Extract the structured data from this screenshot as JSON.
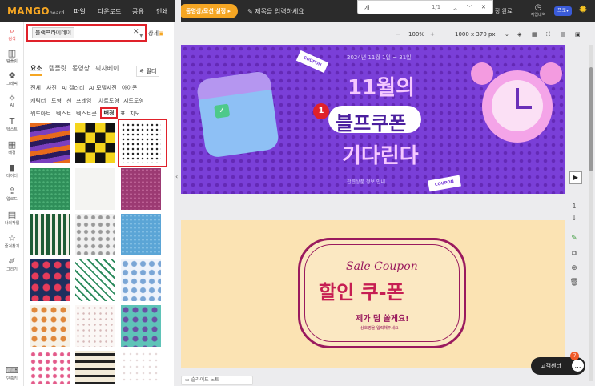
{
  "app": {
    "logo": "MANGO",
    "logo_sub": "board"
  },
  "topbar": {
    "menus": [
      "파일",
      "다운로드",
      "공유",
      "인쇄"
    ],
    "video_button": "동영상/모션 설정",
    "title_placeholder": "제목을 입력하세요",
    "find": {
      "query": "개",
      "count": "1/1"
    },
    "save_status": "장 완료",
    "worklog_label": "작업내역",
    "pro_label": "프로"
  },
  "leftnav": [
    {
      "label": "검색",
      "icon": "search-icon"
    },
    {
      "label": "템플릿",
      "icon": "template-icon"
    },
    {
      "label": "그래픽",
      "icon": "graphic-icon"
    },
    {
      "label": "AI",
      "icon": "ai-icon"
    },
    {
      "label": "텍스트",
      "icon": "text-icon"
    },
    {
      "label": "배경",
      "icon": "background-icon"
    },
    {
      "label": "데이터",
      "icon": "chart-icon"
    },
    {
      "label": "업로드",
      "icon": "upload-icon"
    },
    {
      "label": "나의작업",
      "icon": "folder-icon"
    },
    {
      "label": "즐겨찾기",
      "icon": "star-icon"
    },
    {
      "label": "그리기",
      "icon": "brush-icon"
    },
    {
      "label": "단축키",
      "icon": "keyboard-icon"
    }
  ],
  "search": {
    "tag": "블랙프라이데이",
    "detail": "상세"
  },
  "panel_tabs": [
    "요소",
    "템플릿",
    "동영상",
    "픽사베이"
  ],
  "filter_label": "필터",
  "category_chips": {
    "row1": [
      "전체",
      "사진",
      "AI 갤러리",
      "AI 모델사진",
      "아이콘"
    ],
    "row2": [
      "캐릭터",
      "도형",
      "선",
      "프레임",
      "차트도형",
      "지도도형"
    ],
    "row3": [
      "워드아트",
      "텍스트",
      "텍스트콘",
      "배경",
      "표",
      "지도"
    ]
  },
  "canvas1": {
    "date": "2024년 11월 1일 ~ 31일",
    "title1": "11월의",
    "title2": "블프쿠폰",
    "title3": "기다린다",
    "footer": "관련상품 정보 안내",
    "badge": "1",
    "coupon": "COUPON"
  },
  "canvas2": {
    "script": "Sale Coupon",
    "title": "할인 쿠-폰",
    "sub": "제가 덤 쏠게요!",
    "small": "상호명을 입력해주세요"
  },
  "zoom": {
    "value": "100%",
    "size": "1000 x 370 px"
  },
  "page_number": "1",
  "note_label": "슬라이드 노트",
  "customer_center": "고객센터",
  "cs_badge": "7",
  "colors": {
    "accent": "#f5a623",
    "topbar": "#2b2b2b",
    "highlight": "#e0212a",
    "canvas1": "#7a3fd8",
    "canvas2": "#fbe3b3"
  }
}
